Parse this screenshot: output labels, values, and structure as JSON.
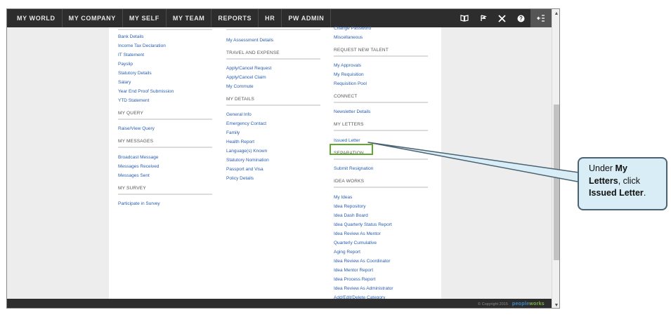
{
  "topnav": {
    "items": [
      "MY WORLD",
      "MY COMPANY",
      "MY SELF",
      "MY TEAM",
      "REPORTS",
      "HR",
      "PW ADMIN"
    ],
    "icons": [
      "book-icon",
      "flag-icon",
      "tools-icon",
      "help-icon",
      "menu-toggle-icon"
    ]
  },
  "col1": {
    "items": [
      "Bank Details",
      "Income Tax Declaration",
      "IT Statement",
      "Payslip",
      "Statutory Details",
      "Salary",
      "Year End Proof Submission",
      "YTD Statement"
    ],
    "my_query": {
      "heading": "MY QUERY",
      "items": [
        "Raise/View Query"
      ]
    },
    "my_messages": {
      "heading": "MY MESSAGES",
      "items": [
        "Broadcast Message",
        "Messages Received",
        "Messages Sent"
      ]
    },
    "my_survey": {
      "heading": "MY SURVEY",
      "items": [
        "Participate in Survey"
      ]
    }
  },
  "col2": {
    "items": [
      "My Assessment Details"
    ],
    "travel": {
      "heading": "TRAVEL AND EXPENSE",
      "items": [
        "Apply/Cancel Request",
        "Apply/Cancel Claim",
        "My Commute"
      ]
    },
    "my_details": {
      "heading": "MY DETAILS",
      "items": [
        "General Info",
        "Emergency Contact",
        "Family",
        "Health Report",
        "Language(s) Known",
        "Statutory Nomination",
        "Passport and Visa",
        "Policy Details"
      ]
    }
  },
  "col3": {
    "items": [
      "Change Password",
      "Miscellaneous"
    ],
    "request_talent": {
      "heading": "REQUEST NEW TALENT",
      "items": [
        "My Approvals",
        "My Requisition",
        "Requisition Pool"
      ]
    },
    "connect": {
      "heading": "CONNECT",
      "items": [
        "Newsletter Details"
      ]
    },
    "my_letters": {
      "heading": "MY LETTERS",
      "items": [
        "Issued Letter"
      ]
    },
    "separation": {
      "heading": "SEPARATION",
      "items": [
        "Submit Resignation"
      ]
    },
    "idea_works": {
      "heading": "IDEA WORKS",
      "items": [
        "My Ideas",
        "Idea Repository",
        "Idea Dash Board",
        "Idea Quarterly Status Report",
        "Idea Review As Mentor",
        "Quarterly Cumulative",
        "Aging Report",
        "Idea Review As Coordinator",
        "Idea Mentor Report",
        "Idea Process Report",
        "Idea Review As Administrator",
        "Add/Edit/Delete Category"
      ]
    }
  },
  "footer": {
    "copyright": "© Copyright 2015",
    "brand_main": "people",
    "brand_accent": "works"
  },
  "callout": {
    "t1": "Under ",
    "b1": "My Letters",
    "t2": ", click ",
    "b2": "Issued Letter",
    "t3": "."
  },
  "colors": {
    "nav_bg": "#2d2d2d",
    "link": "#2a5db0",
    "highlight": "#5fa832",
    "callout_bg": "#d8edf5",
    "callout_border": "#4a6272"
  }
}
